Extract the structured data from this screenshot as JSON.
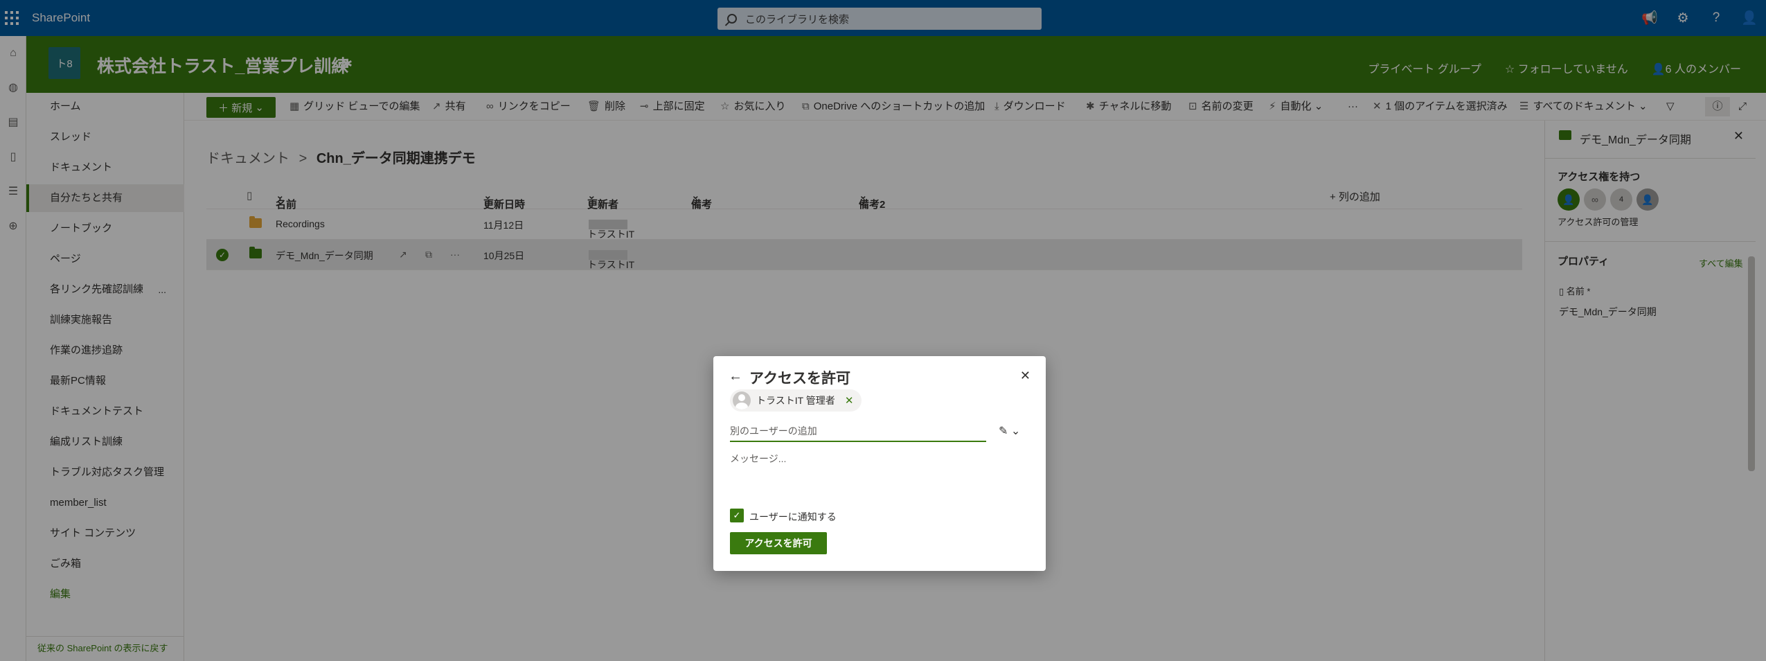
{
  "suitebar": {
    "brand": "SharePoint",
    "search_placeholder": "このライブラリを検索",
    "icons": [
      "megaphone-icon",
      "gear-icon",
      "help-icon",
      "person-icon"
    ]
  },
  "site": {
    "logo_text": "ト8",
    "title": "株式会社トラスト_営業プレ訓練",
    "privacy": "プライベート グループ",
    "follow": "☆ フォローしていません",
    "members": "6 人のメンバー"
  },
  "nav": {
    "items": [
      {
        "label": "ホーム"
      },
      {
        "label": "スレッド"
      },
      {
        "label": "ドキュメント"
      },
      {
        "label": "自分たちと共有"
      },
      {
        "label": "ノートブック"
      },
      {
        "label": "ページ"
      },
      {
        "label": "各リンク先確認訓練"
      },
      {
        "label": "訓練実施報告"
      },
      {
        "label": "作業の進捗追跡"
      },
      {
        "label": "最新PC情報"
      },
      {
        "label": "ドキュメントテスト"
      },
      {
        "label": "編成リスト訓練"
      },
      {
        "label": "トラブル対応タスク管理"
      },
      {
        "label": "member_list"
      },
      {
        "label": "サイト コンテンツ"
      },
      {
        "label": "ごみ箱"
      },
      {
        "label": "編集"
      }
    ],
    "more": "...",
    "footer": "従来の SharePoint の表示に戻す"
  },
  "cmdbar": {
    "new": "新規",
    "grid_edit": "グリッド ビューでの編集",
    "share": "共有",
    "copy_link": "リンクをコピー",
    "delete": "削除",
    "pin": "上部に固定",
    "favorite": "お気に入り",
    "onedrive": "OneDrive へのショートカットの追加",
    "download": "ダウンロード",
    "move_channel": "チャネルに移動",
    "rename": "名前の変更",
    "automate": "自動化",
    "more": "···",
    "selected": "1 個のアイテムを選択済み",
    "all_docs": "すべてのドキュメント"
  },
  "breadcrumb": {
    "parent": "ドキュメント",
    "separator": ">",
    "current": "Chn_データ同期連携デモ"
  },
  "columns": {
    "name": "名前",
    "modified": "更新日時",
    "modified_by": "更新者",
    "note": "備考",
    "note2": "備考2",
    "add": "+ 列の追加"
  },
  "rows": [
    {
      "name": "Recordings",
      "modified": "11月12日",
      "modified_by": "トラストIT",
      "folder_color": "#e8a93a",
      "selected": false
    },
    {
      "name": "デモ_Mdn_データ同期",
      "modified": "10月25日",
      "modified_by": "トラストIT",
      "folder_color": "#3a7a0f",
      "selected": true
    }
  ],
  "row_actions": "···",
  "pane": {
    "title": "デモ_Mdn_データ同期",
    "access_heading": "アクセス権を持つ",
    "manage_access": "アクセス許可の管理",
    "avatar_count": "4",
    "properties_heading": "プロパティ",
    "edit_all": "すべて編集",
    "name_label": "名前 *",
    "name_value": "デモ_Mdn_データ同期"
  },
  "dialog": {
    "title": "アクセスを許可",
    "chip_user": "トラストIT 管理者",
    "add_user_placeholder": "別のユーザーの追加",
    "message_placeholder": "メッセージ...",
    "notify_label": "ユーザーに通知する",
    "grant_button": "アクセスを許可"
  },
  "colors": {
    "suitebar": "#005a9e",
    "theme_green": "#3a7a0f",
    "site_logo": "#1f6f78"
  }
}
